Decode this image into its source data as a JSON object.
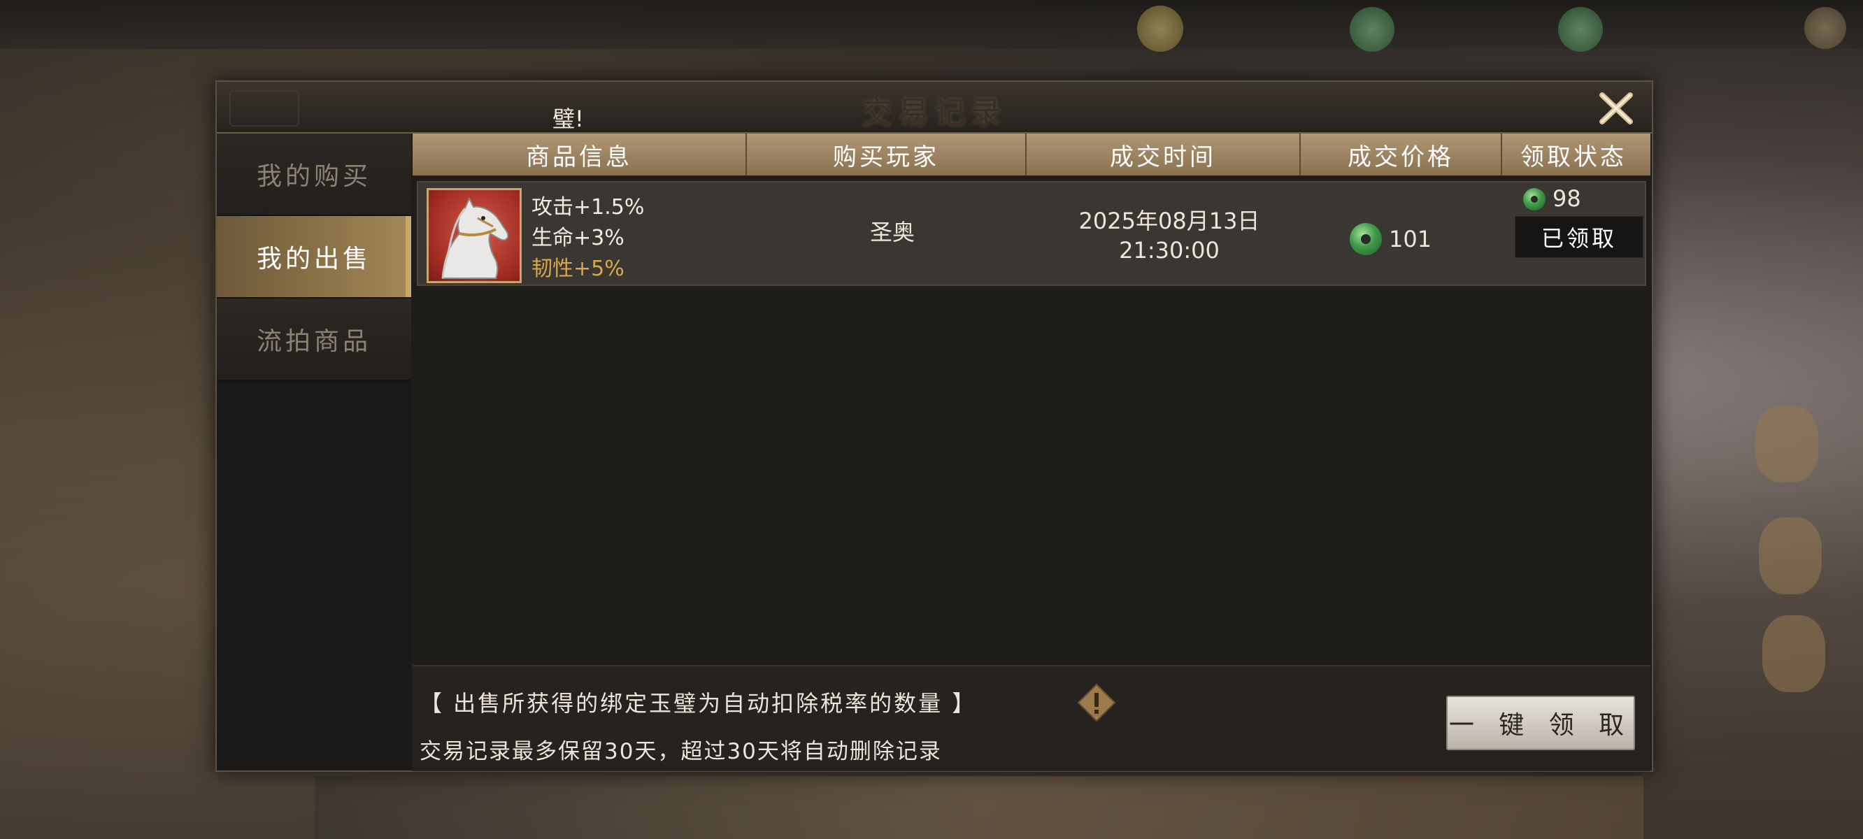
{
  "dialog": {
    "title": "交易记录",
    "marquee": "璧!"
  },
  "sidebar": {
    "items": [
      {
        "label": "我的购买",
        "active": false
      },
      {
        "label": "我的出售",
        "active": true
      },
      {
        "label": "流拍商品",
        "active": false
      }
    ]
  },
  "table": {
    "headers": [
      "商品信息",
      "购买玩家",
      "成交时间",
      "成交价格",
      "领取状态"
    ],
    "rows": [
      {
        "icon": "white-horse-icon",
        "attrs": [
          "攻击+1.5%",
          "生命+3%",
          "韧性+5%"
        ],
        "buyer": "圣奥",
        "date": "2025年08月13日",
        "time": "21:30:00",
        "price": "101",
        "received": "98",
        "status": "已领取"
      }
    ]
  },
  "footer": {
    "note1": "【 出售所获得的绑定玉璧为自动扣除税率的数量 】",
    "note2": "交易记录最多保留30天，超过30天将自动删除记录",
    "claim_all": "一 键 领 取"
  },
  "colors": {
    "accent_gold": "#a38858",
    "header_bg": "#b09673",
    "attr_gold": "#d6a84a",
    "jade_green": "#3f9a4a"
  }
}
